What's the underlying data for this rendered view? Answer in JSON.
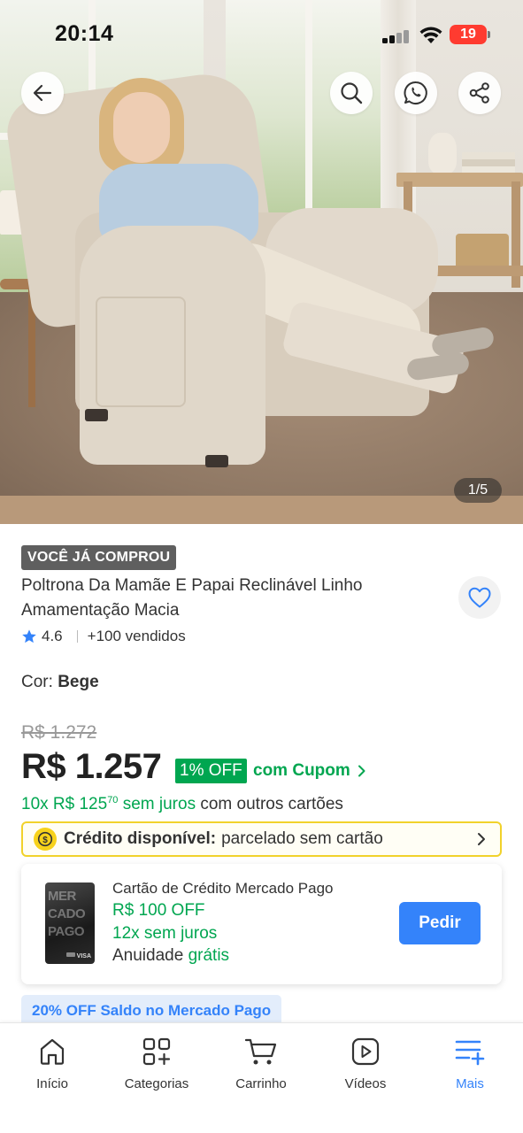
{
  "status_bar": {
    "time": "20:14",
    "battery": "19"
  },
  "gallery": {
    "page_indicator": "1/5"
  },
  "product": {
    "badge": "VOCÊ JÁ COMPROU",
    "title": "Poltrona Da Mamãe E Papai Reclinável Linho Amamentação Macia",
    "rating": "4.6",
    "sold": "+100 vendidos",
    "color_label": "Cor:",
    "color_value": "Bege"
  },
  "pricing": {
    "old_price": "R$ 1.272",
    "price": "R$ 1.257",
    "off_badge": "1% OFF",
    "coupon": "com Cupom",
    "installments_prefix": "10x R$ 125",
    "installments_cents": "70",
    "installments_green": "sem juros",
    "installments_suffix": "com outros cartões"
  },
  "credit": {
    "label": "Crédito disponível:",
    "text": "parcelado sem cartão"
  },
  "card_offer": {
    "title": "Cartão de Crédito Mercado Pago",
    "off": "R$ 100 OFF",
    "installments": "12x sem juros",
    "annual_label": "Anuidade",
    "annual_value": "grátis",
    "button": "Pedir",
    "card_art_text": "MER\nCADO\nPAGO",
    "card_brand": "VISA"
  },
  "promo": {
    "text": "20% OFF Saldo no Mercado Pago"
  },
  "bottom_nav": [
    {
      "label": "Início",
      "icon": "home-icon"
    },
    {
      "label": "Categorias",
      "icon": "categories-icon"
    },
    {
      "label": "Carrinho",
      "icon": "cart-icon"
    },
    {
      "label": "Vídeos",
      "icon": "video-icon"
    },
    {
      "label": "Mais",
      "icon": "menu-plus-icon"
    }
  ],
  "colors": {
    "accent_blue": "#3483fa",
    "green": "#00a650",
    "credit_yellow": "#f1d22b",
    "battery_red": "#ff3b30"
  }
}
